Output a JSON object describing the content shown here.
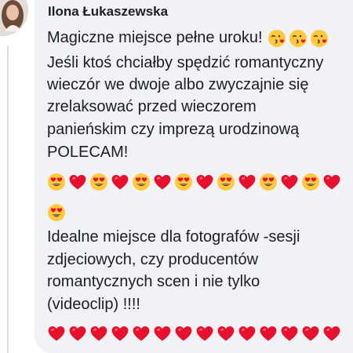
{
  "comment": {
    "author": "Ilona Łukaszewska",
    "paragraph1": [
      "Magiczne miejsce pełne uroku!",
      "Jeśli ktoś chciałby spędzić romantyczny",
      "wieczór we dwoje albo zwyczajnie się",
      "zrelaksować przed wieczorem",
      "panieńskim czy imprezą urodzinową",
      "POLECAM!"
    ],
    "paragraph2": [
      "Idealne miejsce dla fotografów -sesji",
      "zdjeciowych,  czy producentów",
      "romantycznych scen  i nie tylko",
      "(videoclip) !!!!"
    ],
    "emoji_rows": {
      "inline_after_first_line": [
        "kissing-heart-face-icon",
        "kissing-heart-face-icon",
        "kissing-heart-face-icon"
      ],
      "row1": [
        "heart-eyes-face-icon",
        "red-heart-icon",
        "heart-eyes-face-icon",
        "red-heart-icon",
        "heart-eyes-face-icon",
        "red-heart-icon",
        "heart-eyes-face-icon",
        "red-heart-icon",
        "heart-eyes-face-icon",
        "red-heart-icon",
        "heart-eyes-face-icon",
        "red-heart-icon",
        "heart-eyes-face-icon",
        "red-heart-icon"
      ],
      "row2": [
        "heart-eyes-face-icon"
      ],
      "row3": [
        "red-heart-icon",
        "red-heart-icon",
        "red-heart-icon",
        "red-heart-icon",
        "red-heart-icon",
        "red-heart-icon",
        "red-heart-icon",
        "red-heart-icon",
        "red-heart-icon",
        "red-heart-icon",
        "red-heart-icon",
        "red-heart-icon",
        "red-heart-icon",
        "red-heart-icon"
      ]
    }
  },
  "colors": {
    "bubble": "#f0f2f5",
    "text": "#1c1e21",
    "heart": "#e8112d",
    "face": "#ffc83d"
  }
}
